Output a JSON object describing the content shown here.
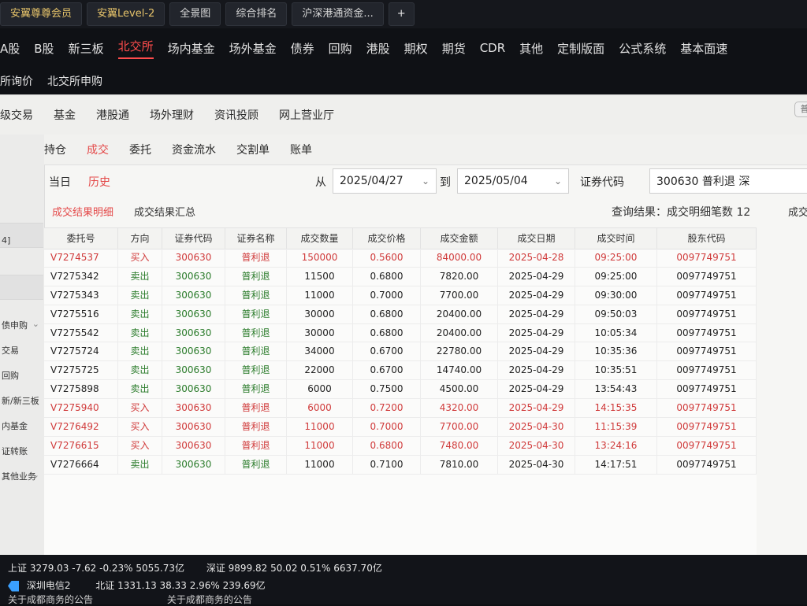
{
  "tabs": [
    {
      "label": "安翼尊尊会员"
    },
    {
      "label": "安翼Level-2"
    },
    {
      "label": "全景图"
    },
    {
      "label": "综合排名"
    },
    {
      "label": "沪深港通资金..."
    },
    {
      "label": "+"
    }
  ],
  "categories": [
    {
      "label": "A股"
    },
    {
      "label": "B股"
    },
    {
      "label": "新三板"
    },
    {
      "label": "北交所"
    },
    {
      "label": "场内基金"
    },
    {
      "label": "场外基金"
    },
    {
      "label": "债券"
    },
    {
      "label": "回购"
    },
    {
      "label": "港股"
    },
    {
      "label": "期权"
    },
    {
      "label": "期货"
    },
    {
      "label": "CDR"
    },
    {
      "label": "其他"
    },
    {
      "label": "定制版面"
    },
    {
      "label": "公式系统"
    },
    {
      "label": "基本面速"
    }
  ],
  "subrow": [
    {
      "label": "所询价"
    },
    {
      "label": "北交所申购"
    }
  ],
  "panelMenu": [
    {
      "label": "级交易"
    },
    {
      "label": "基金"
    },
    {
      "label": "港股通"
    },
    {
      "label": "场外理财"
    },
    {
      "label": "资讯投顾"
    },
    {
      "label": "网上营业厅"
    }
  ],
  "panelRight": "普",
  "sidebar": [
    {
      "label": "4]"
    },
    {
      "label": "债申购"
    },
    {
      "label": "交易"
    },
    {
      "label": "回购"
    },
    {
      "label": "新/新三板"
    },
    {
      "label": "内基金"
    },
    {
      "label": "证转账"
    },
    {
      "label": "其他业务"
    }
  ],
  "subTabs": [
    {
      "label": "持仓"
    },
    {
      "label": "成交"
    },
    {
      "label": "委托"
    },
    {
      "label": "资金流水"
    },
    {
      "label": "交割单"
    },
    {
      "label": "账单"
    }
  ],
  "filters": {
    "today": "当日",
    "history": "历史",
    "from": "从",
    "to": "到",
    "startDate": "2025/04/27",
    "endDate": "2025/05/04",
    "codeLabel": "证券代码",
    "codeValue": "300630 普利退 深"
  },
  "results": {
    "detailTab": "成交结果明细",
    "summaryTab": "成交结果汇总",
    "queryText": "查询结果：成交明细笔数 12",
    "queryTail": "成交"
  },
  "table": {
    "headers": [
      "委托号",
      "方向",
      "证券代码",
      "证券名称",
      "成交数量",
      "成交价格",
      "成交金额",
      "成交日期",
      "成交时间",
      "股东代码"
    ],
    "rows": [
      {
        "id": "V7274537",
        "dir": "买入",
        "code": "300630",
        "name": "普利退",
        "qty": "150000",
        "price": "0.5600",
        "amount": "84000.00",
        "date": "2025-04-28",
        "time": "09:25:00",
        "holder": "0097749751"
      },
      {
        "id": "V7275342",
        "dir": "卖出",
        "code": "300630",
        "name": "普利退",
        "qty": "11500",
        "price": "0.6800",
        "amount": "7820.00",
        "date": "2025-04-29",
        "time": "09:25:00",
        "holder": "0097749751"
      },
      {
        "id": "V7275343",
        "dir": "卖出",
        "code": "300630",
        "name": "普利退",
        "qty": "11000",
        "price": "0.7000",
        "amount": "7700.00",
        "date": "2025-04-29",
        "time": "09:30:00",
        "holder": "0097749751"
      },
      {
        "id": "V7275516",
        "dir": "卖出",
        "code": "300630",
        "name": "普利退",
        "qty": "30000",
        "price": "0.6800",
        "amount": "20400.00",
        "date": "2025-04-29",
        "time": "09:50:03",
        "holder": "0097749751"
      },
      {
        "id": "V7275542",
        "dir": "卖出",
        "code": "300630",
        "name": "普利退",
        "qty": "30000",
        "price": "0.6800",
        "amount": "20400.00",
        "date": "2025-04-29",
        "time": "10:05:34",
        "holder": "0097749751"
      },
      {
        "id": "V7275724",
        "dir": "卖出",
        "code": "300630",
        "name": "普利退",
        "qty": "34000",
        "price": "0.6700",
        "amount": "22780.00",
        "date": "2025-04-29",
        "time": "10:35:36",
        "holder": "0097749751"
      },
      {
        "id": "V7275725",
        "dir": "卖出",
        "code": "300630",
        "name": "普利退",
        "qty": "22000",
        "price": "0.6700",
        "amount": "14740.00",
        "date": "2025-04-29",
        "time": "10:35:51",
        "holder": "0097749751"
      },
      {
        "id": "V7275898",
        "dir": "卖出",
        "code": "300630",
        "name": "普利退",
        "qty": "6000",
        "price": "0.7500",
        "amount": "4500.00",
        "date": "2025-04-29",
        "time": "13:54:43",
        "holder": "0097749751"
      },
      {
        "id": "V7275940",
        "dir": "买入",
        "code": "300630",
        "name": "普利退",
        "qty": "6000",
        "price": "0.7200",
        "amount": "4320.00",
        "date": "2025-04-29",
        "time": "14:15:35",
        "holder": "0097749751"
      },
      {
        "id": "V7276492",
        "dir": "买入",
        "code": "300630",
        "name": "普利退",
        "qty": "11000",
        "price": "0.7000",
        "amount": "7700.00",
        "date": "2025-04-30",
        "time": "11:15:39",
        "holder": "0097749751"
      },
      {
        "id": "V7276615",
        "dir": "买入",
        "code": "300630",
        "name": "普利退",
        "qty": "11000",
        "price": "0.6800",
        "amount": "7480.00",
        "date": "2025-04-30",
        "time": "13:24:16",
        "holder": "0097749751"
      },
      {
        "id": "V7276664",
        "dir": "卖出",
        "code": "300630",
        "name": "普利退",
        "qty": "11000",
        "price": "0.7100",
        "amount": "7810.00",
        "date": "2025-04-30",
        "time": "14:17:51",
        "holder": "0097749751"
      }
    ]
  },
  "status": {
    "sh": "上证 3279.03 -7.62 -0.23% 5055.73亿",
    "sz": "深证 9899.82 50.02 0.51% 6637.70亿",
    "bz": "北证 1331.13 38.33 2.96% 239.69亿",
    "telecom": "深圳电信2",
    "news1": "关于成都商务的公告",
    "news2": "关于成都商务的公告"
  },
  "colors": {
    "accentRed": "#e44a4a",
    "gold": "#e6c36a",
    "green": "#2a7b2a"
  }
}
